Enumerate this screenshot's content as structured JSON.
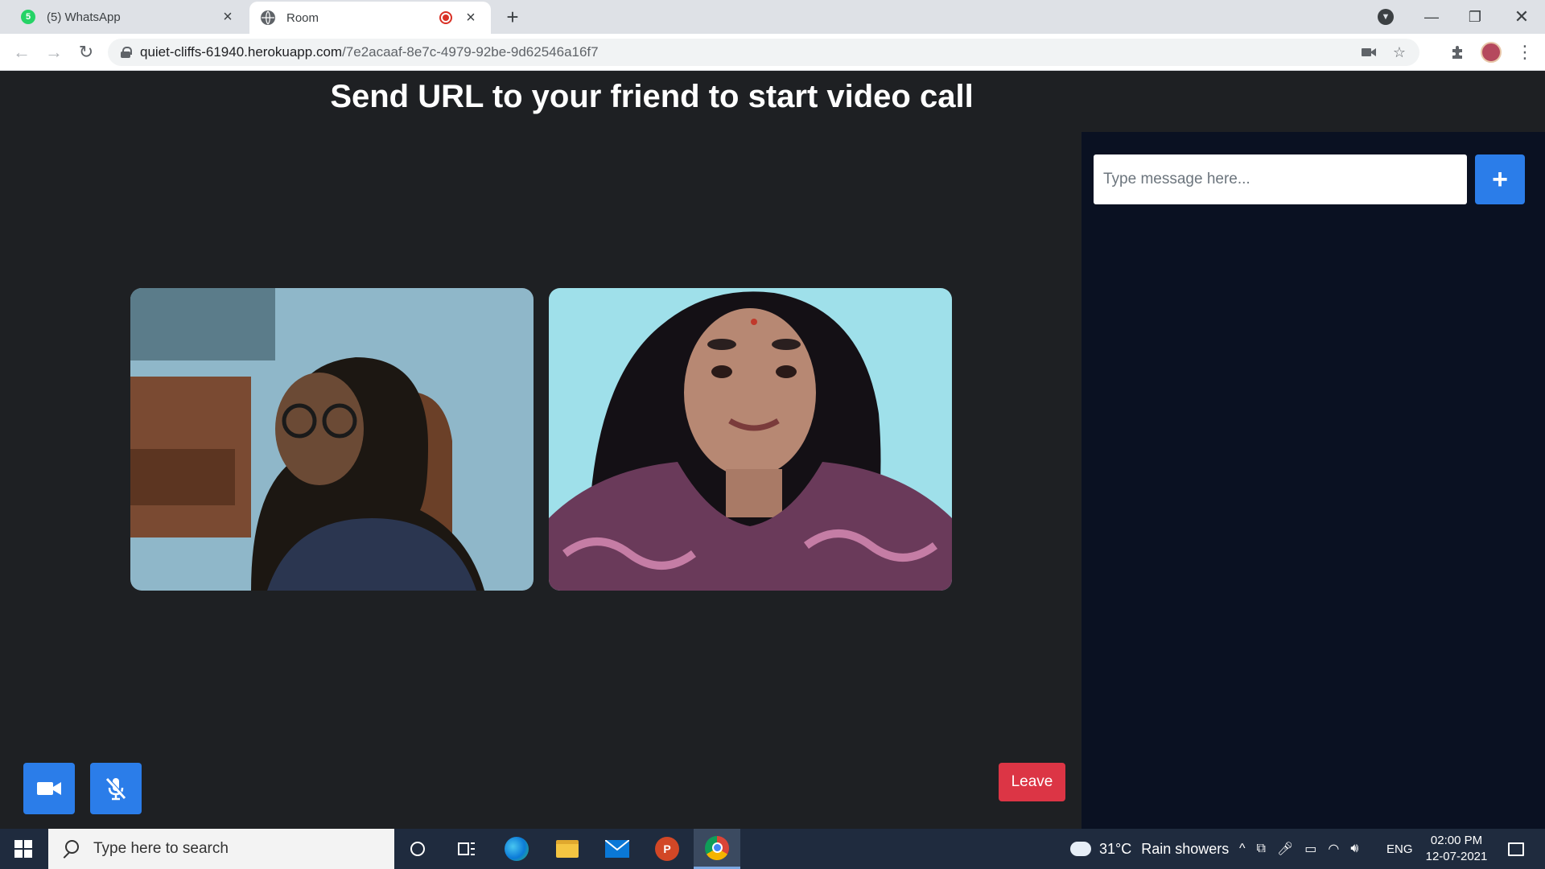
{
  "browser": {
    "tabs": [
      {
        "title": "(5) WhatsApp",
        "badge": "5",
        "favicon": "whatsapp-icon"
      },
      {
        "title": "Room",
        "favicon": "globe-icon",
        "recording": true
      }
    ],
    "url_host": "quiet-cliffs-61940.herokuapp.com",
    "url_path": "/7e2acaaf-8e7c-4979-92be-9d62546a16f7"
  },
  "page": {
    "title": "Send URL to your friend to start video call",
    "leave_label": "Leave",
    "chat": {
      "placeholder": "Type message here...",
      "send_icon": "+"
    },
    "colors": {
      "primary": "#2b7de9",
      "danger": "#dc3545",
      "background": "#1e2023",
      "chat_panel": "#0a1122"
    }
  },
  "taskbar": {
    "search_placeholder": "Type here to search",
    "apps": [
      "cortana-icon",
      "task-view-icon",
      "edge-icon",
      "file-explorer-icon",
      "mail-icon",
      "powerpoint-icon",
      "chrome-icon"
    ],
    "weather_temp": "31°C",
    "weather_text": "Rain showers",
    "language": "ENG",
    "time": "02:00 PM",
    "date": "12-07-2021"
  }
}
